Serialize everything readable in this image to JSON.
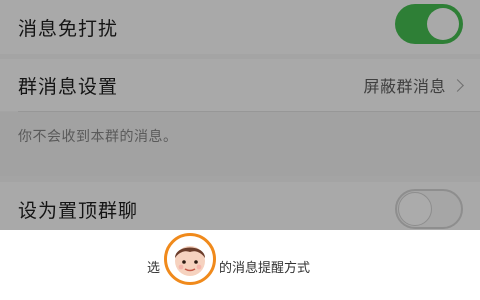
{
  "settings": {
    "mute": {
      "label": "消息免打扰",
      "enabled": true
    },
    "group_messages": {
      "label": "群消息设置",
      "value": "屏蔽群消息"
    },
    "hint": "你不会收到本群的消息。",
    "pin": {
      "label": "设为置顶群聊",
      "enabled": false
    }
  },
  "sheet": {
    "title_left": "选",
    "title_right": "的消息提醒方式"
  },
  "icons": {
    "chevron": "chevron-right-icon",
    "avatar": "cartoon-face-avatar"
  },
  "colors": {
    "toggle_on": "#2e7f36",
    "avatar_ring": "#f08a1c"
  }
}
